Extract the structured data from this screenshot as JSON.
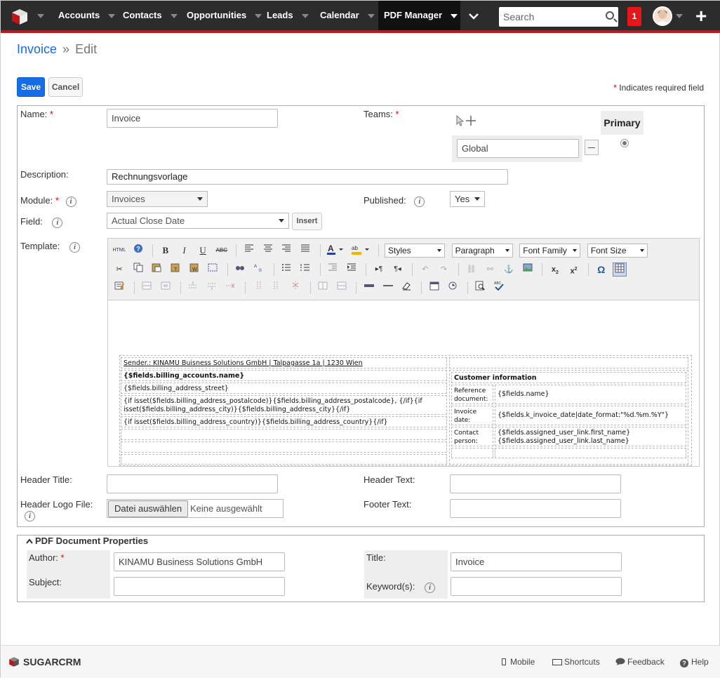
{
  "nav": {
    "items": [
      "Accounts",
      "Contacts",
      "Opportunities",
      "Leads",
      "Calendar",
      "PDF Manager"
    ],
    "search_placeholder": "Search",
    "notification_count": "1"
  },
  "breadcrumb": {
    "module": "Invoice",
    "separator": "»",
    "action": "Edit"
  },
  "actions": {
    "save": "Save",
    "cancel": "Cancel",
    "required_note": "Indicates required field"
  },
  "form": {
    "name_label": "Name:",
    "name_value": "Invoice",
    "teams_label": "Teams:",
    "team_value": "Global",
    "primary_label": "Primary",
    "description_label": "Description:",
    "description_value": "Rechnungsvorlage",
    "module_label": "Module:",
    "module_value": "Invoices",
    "published_label": "Published:",
    "published_value": "Yes",
    "field_label": "Field:",
    "field_value": "Actual Close Date",
    "insert_label": "Insert",
    "template_label": "Template:",
    "header_title_label": "Header Title:",
    "header_text_label": "Header Text:",
    "header_logo_label": "Header Logo File:",
    "file_button": "Datei auswählen",
    "file_status": "Keine ausgewählt",
    "footer_text_label": "Footer Text:"
  },
  "editor": {
    "styles": "Styles",
    "paragraph": "Paragraph",
    "font_family": "Font Family",
    "font_size": "Font Size",
    "sender": "Sender.: KINAMU Buisness Solutions GmbH | Talpagasse 1a | 1230 Wien",
    "left_lines": [
      "{$fields.billing_accounts.name}",
      "{$fields.billing_address_street}",
      "{if isset($fields.billing_address_postalcode)}{$fields.billing_address_postalcode}, {/if}{if isset($fields.billing_address_city)}{$fields.billing_address_city}{/if}",
      "{if isset($fields.billing_address_country)}{$fields.billing_address_country}{/if}"
    ],
    "customer_info_title": "Customer information",
    "info_rows": [
      {
        "label": "Reference document:",
        "value": "{$fields.name}"
      },
      {
        "label": "Invoice date:",
        "value": "{$fields.k_invoice_date|date_format:\"%d.%m.%Y\"}"
      },
      {
        "label": "Contact person:",
        "value": "{$fields.assigned_user_link.first_name} {$fields.assigned_user_link.last_name}"
      }
    ]
  },
  "pdf_props": {
    "title": "PDF Document Properties",
    "author_label": "Author:",
    "author_value": "KINAMU Business Solutions GmbH",
    "title_label": "Title:",
    "title_value": "Invoice",
    "subject_label": "Subject:",
    "keywords_label": "Keyword(s):"
  },
  "footer": {
    "brand": "SUGARCRM",
    "mobile": "Mobile",
    "shortcuts": "Shortcuts",
    "feedback": "Feedback",
    "help": "Help"
  }
}
